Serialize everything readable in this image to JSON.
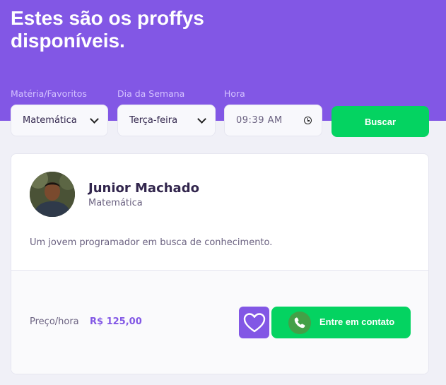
{
  "header": {
    "title": "Estes são os proffys disponíveis."
  },
  "filters": {
    "subject": {
      "label": "Matéria/Favoritos",
      "value": "Matemática"
    },
    "weekday": {
      "label": "Dia da Semana",
      "value": "Terça-feira"
    },
    "time": {
      "label": "Hora",
      "value": "09:39 AM"
    },
    "search_label": "Buscar"
  },
  "teacher": {
    "name": "Junior Machado",
    "subject": "Matemática",
    "bio": "Um jovem programador em busca de conhecimento.",
    "price_label": "Preço/hora",
    "price_value": "R$ 125,00",
    "contact_label": "Entre em contato"
  },
  "colors": {
    "primary": "#8257E5",
    "secondary": "#04D361",
    "background": "#F0F0F7"
  },
  "icons": {
    "favorite": "heart-outline-icon",
    "contact": "whatsapp-icon",
    "select": "chevron-down-icon",
    "time": "clock-icon"
  }
}
